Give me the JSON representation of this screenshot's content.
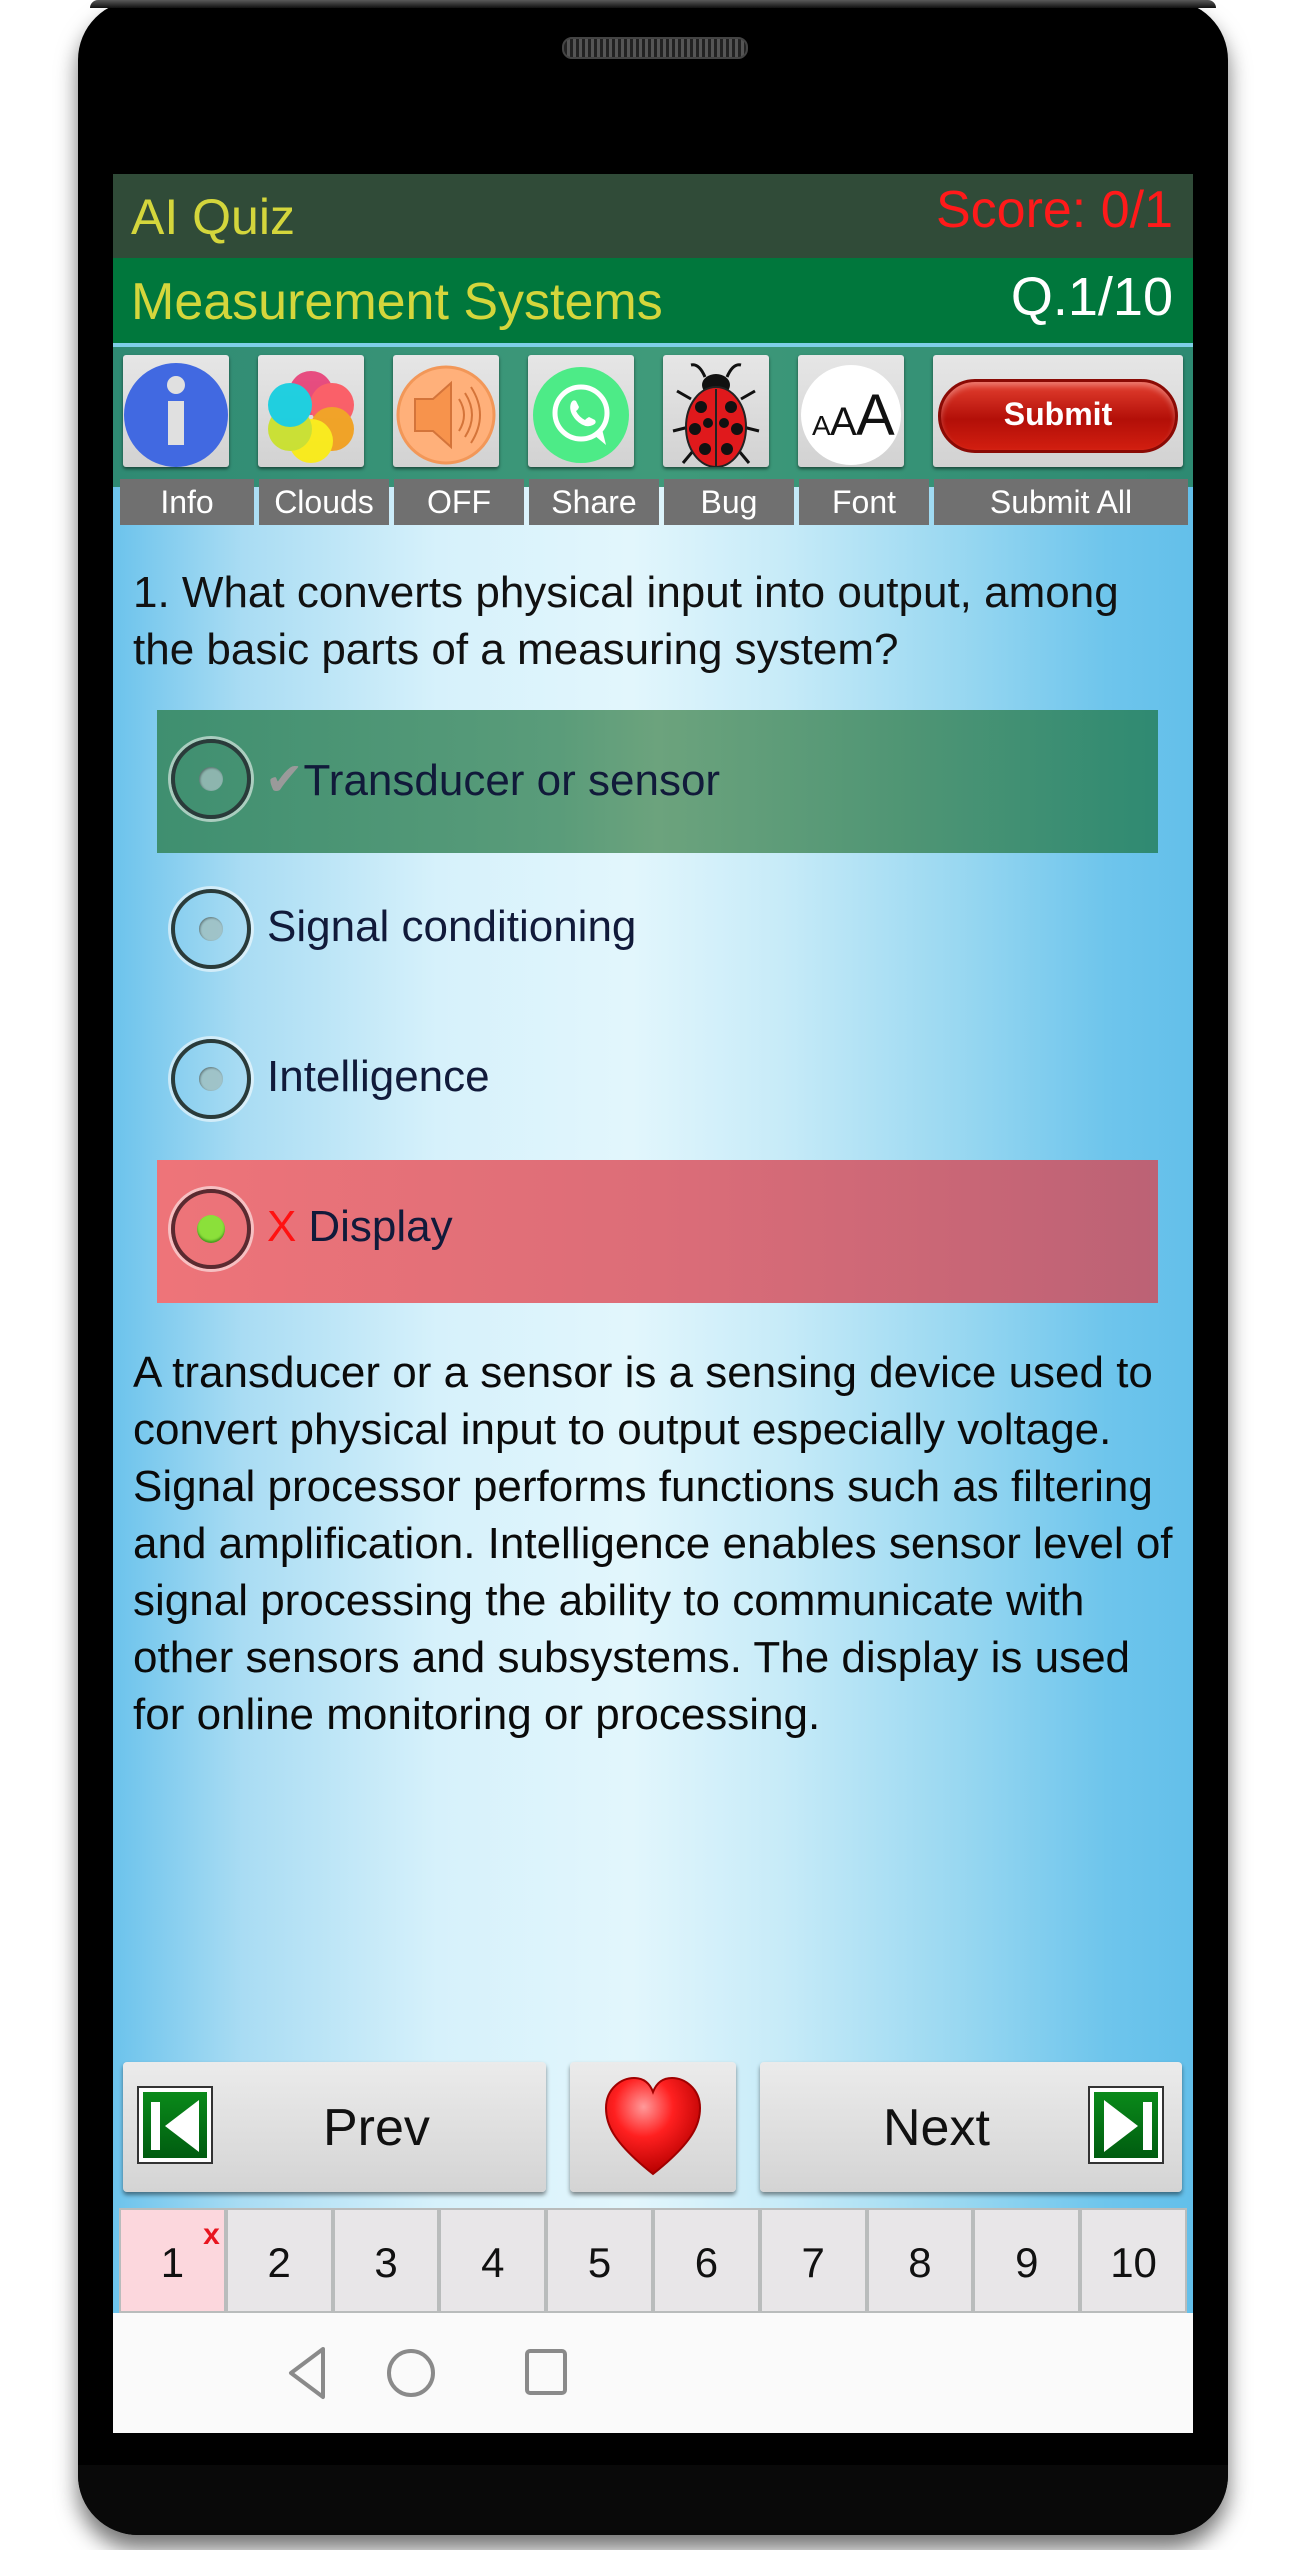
{
  "header": {
    "app_title": "AI Quiz",
    "score": "Score: 0/1",
    "subject": "Measurement Systems",
    "question_counter": "Q.1/10"
  },
  "toolbar": {
    "items": [
      {
        "icon": "info-icon",
        "label": "Info"
      },
      {
        "icon": "clouds-icon",
        "label": "Clouds"
      },
      {
        "icon": "speaker-icon",
        "label": "OFF"
      },
      {
        "icon": "whatsapp-icon",
        "label": "Share"
      },
      {
        "icon": "ladybug-icon",
        "label": "Bug"
      },
      {
        "icon": "font-size-icon",
        "label": "Font",
        "glyph_small": "A",
        "glyph_mid": "A",
        "glyph_large": "A"
      },
      {
        "icon": "submit-icon",
        "label": "Submit All",
        "button_text": "Submit"
      }
    ]
  },
  "question": {
    "text": "1. What converts physical input into output, among the basic parts of a measuring system?",
    "options": [
      {
        "text": "Transducer or sensor",
        "state": "correct",
        "mark": "✔",
        "selected": false
      },
      {
        "text": "Signal conditioning",
        "state": "neutral",
        "mark": "",
        "selected": false
      },
      {
        "text": "Intelligence",
        "state": "neutral",
        "mark": "",
        "selected": false
      },
      {
        "text": "Display",
        "state": "wrong",
        "mark": "X",
        "selected": true
      }
    ],
    "explanation": "A transducer or a sensor is a sensing device used to convert physical input to output especially voltage. Signal processor performs functions such as filtering and amplification. Intelligence enables sensor level of signal processing the ability to communicate with other sensors and subsystems. The display is used for online monitoring or processing."
  },
  "navigation": {
    "prev_label": "Prev",
    "next_label": "Next",
    "favorite_icon": "heart-icon"
  },
  "question_strip": {
    "numbers": [
      "1",
      "2",
      "3",
      "4",
      "5",
      "6",
      "7",
      "8",
      "9",
      "10"
    ],
    "current": "1",
    "wrong_mark": "x"
  },
  "system_nav": {
    "back": "back-icon",
    "home": "home-icon",
    "recents": "recents-icon"
  },
  "colors": {
    "title_bar": "#304b38",
    "subject_bar": "#00773c",
    "title_text": "#d4d63c",
    "score_text": "#ff1a1a",
    "correct_option": "#4f9574",
    "wrong_option": "#dc6d78",
    "submit_button": "#c8150c"
  }
}
